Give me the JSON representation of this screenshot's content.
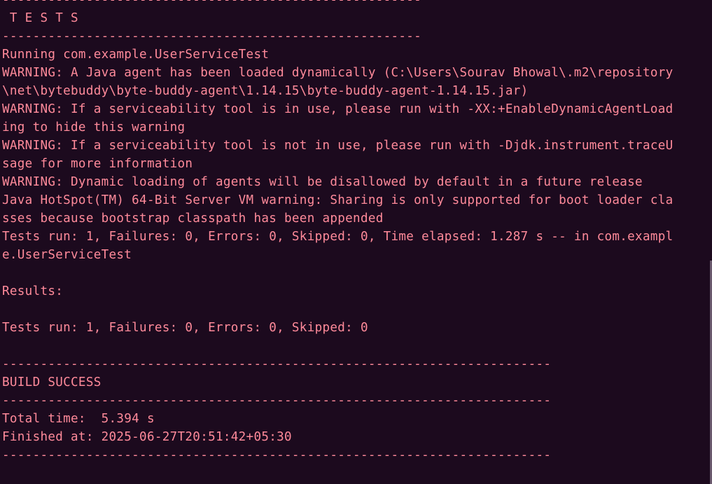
{
  "terminal": {
    "text_color": "#ff8a9a",
    "background_color": "#1c0a1e",
    "lines": [
      "-------------------------------------------------------",
      " T E S T S",
      "-------------------------------------------------------",
      "Running com.example.UserServiceTest",
      "WARNING: A Java agent has been loaded dynamically (C:\\Users\\Sourav Bhowal\\.m2\\repository",
      "\\net\\bytebuddy\\byte-buddy-agent\\1.14.15\\byte-buddy-agent-1.14.15.jar)",
      "WARNING: If a serviceability tool is in use, please run with -XX:+EnableDynamicAgentLoad",
      "ing to hide this warning",
      "WARNING: If a serviceability tool is not in use, please run with -Djdk.instrument.traceU",
      "sage for more information",
      "WARNING: Dynamic loading of agents will be disallowed by default in a future release",
      "Java HotSpot(TM) 64-Bit Server VM warning: Sharing is only supported for boot loader cla",
      "sses because bootstrap classpath has been appended",
      "Tests run: 1, Failures: 0, Errors: 0, Skipped: 0, Time elapsed: 1.287 s -- in com.exampl",
      "e.UserServiceTest",
      "",
      "Results:",
      "",
      "Tests run: 1, Failures: 0, Errors: 0, Skipped: 0",
      "",
      "------------------------------------------------------------------------",
      "BUILD SUCCESS",
      "------------------------------------------------------------------------",
      "Total time:  5.394 s",
      "Finished at: 2025-06-27T20:51:42+05:30",
      "------------------------------------------------------------------------"
    ]
  }
}
